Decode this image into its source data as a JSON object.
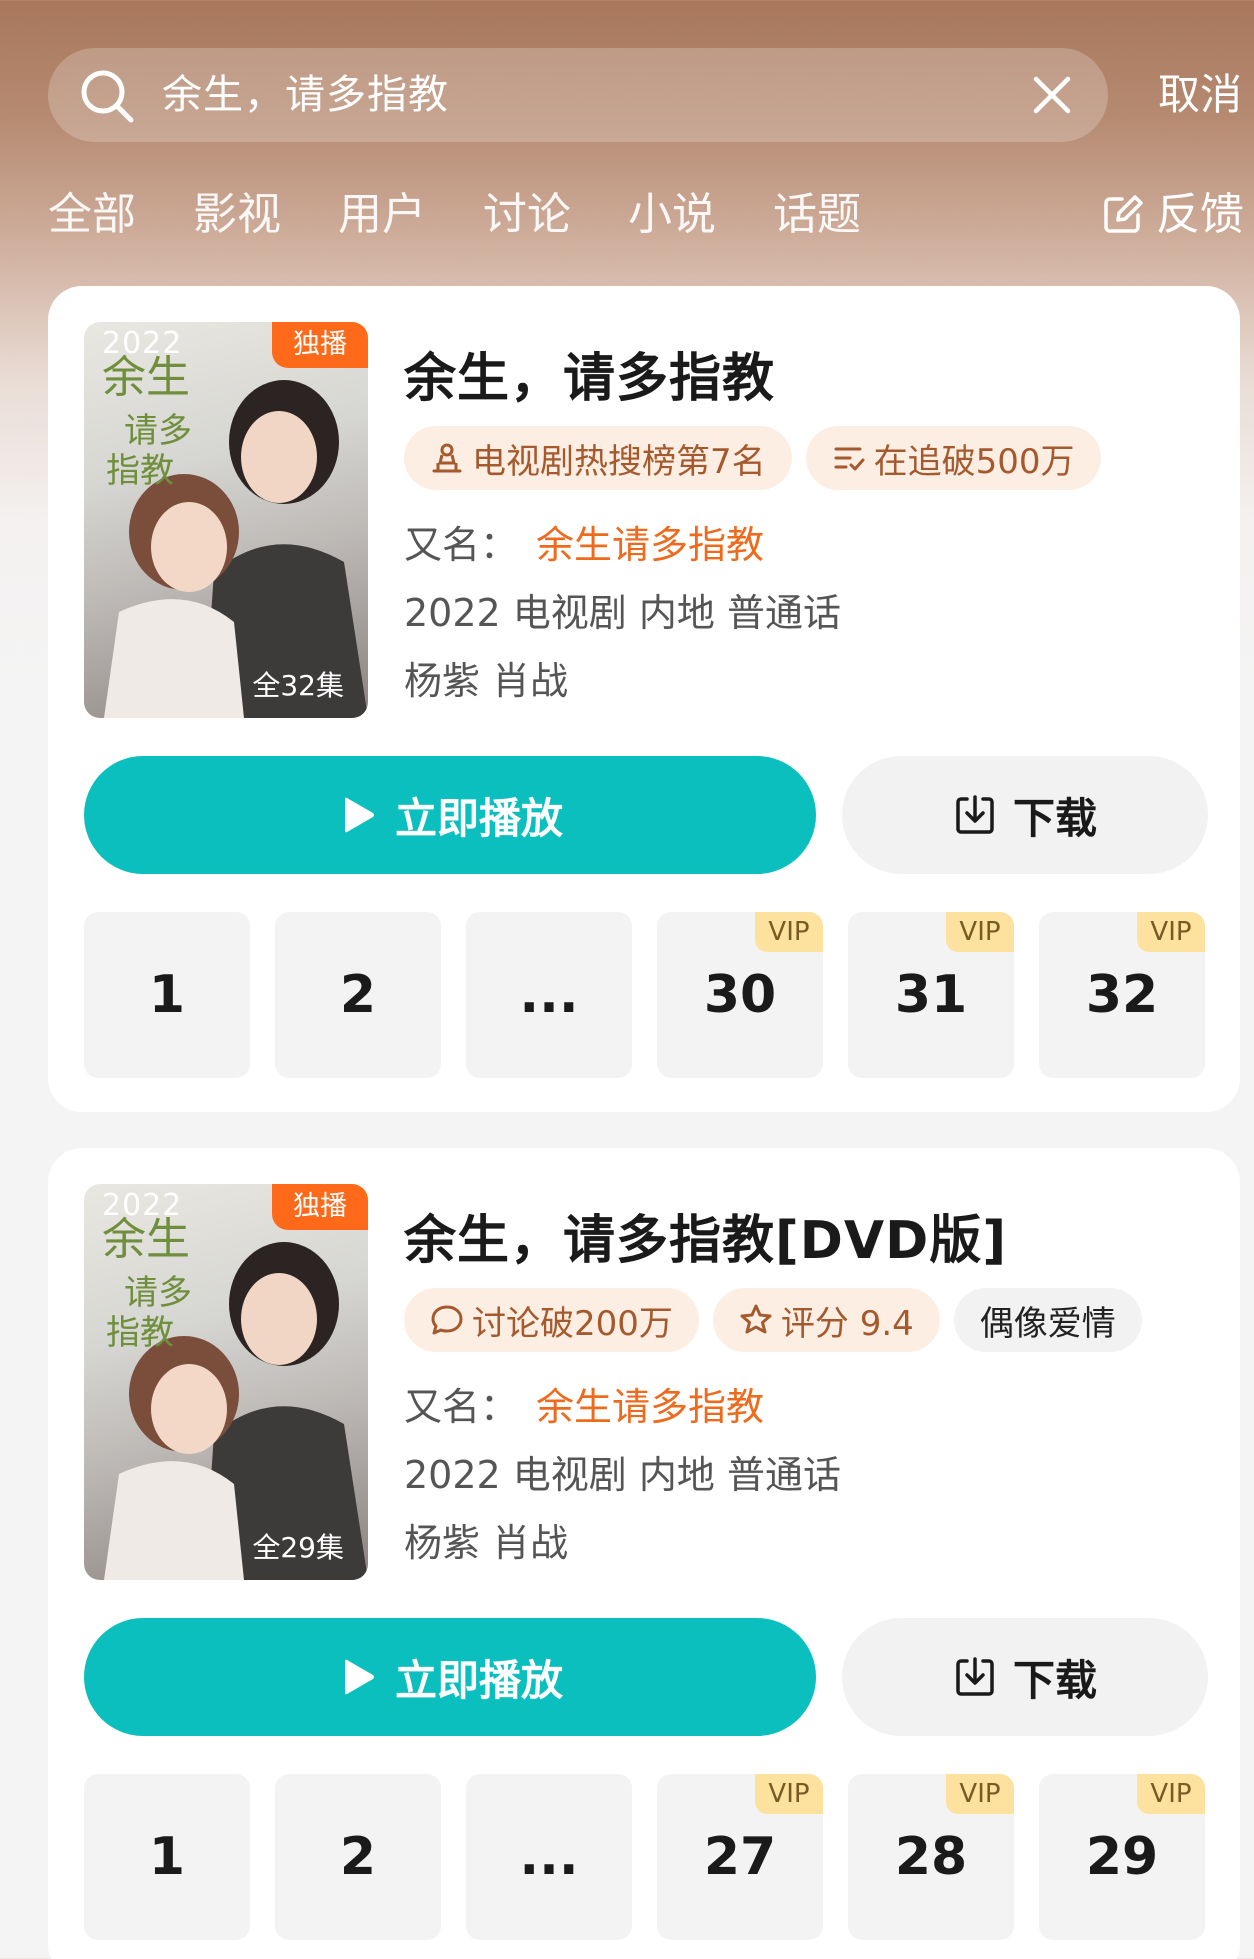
{
  "search": {
    "query": "余生，请多指教",
    "cancel_label": "取消"
  },
  "tabs": [
    "全部",
    "影视",
    "用户",
    "讨论",
    "小说",
    "话题"
  ],
  "feedback_label": "反馈",
  "results": [
    {
      "poster_year": "2022",
      "poster_badge": "独播",
      "poster_episodes": "全32集",
      "title": "余生，请多指教",
      "tags": [
        {
          "icon": "rank-icon",
          "text": "电视剧热搜榜第7名"
        },
        {
          "icon": "follow-list-icon",
          "text": "在追破500万"
        }
      ],
      "alias_label": "又名：",
      "alias_value": "余生请多指教",
      "meta": "2022 电视剧 内地 普通话",
      "cast": "杨紫 肖战",
      "play_label": "立即播放",
      "download_label": "下载",
      "episodes": [
        {
          "label": "1",
          "vip": ""
        },
        {
          "label": "2",
          "vip": ""
        },
        {
          "label": "...",
          "vip": ""
        },
        {
          "label": "30",
          "vip": "VIP"
        },
        {
          "label": "31",
          "vip": "VIP"
        },
        {
          "label": "32",
          "vip": "VIP"
        }
      ]
    },
    {
      "poster_year": "2022",
      "poster_badge": "独播",
      "poster_episodes": "全29集",
      "title": "余生，请多指教[DVD版]",
      "tags": [
        {
          "icon": "comment-icon",
          "text": "讨论破200万"
        },
        {
          "icon": "star-icon",
          "text": "评分 9.4"
        },
        {
          "icon": "",
          "text": "偶像爱情"
        }
      ],
      "alias_label": "又名：",
      "alias_value": "余生请多指教",
      "meta": "2022 电视剧 内地 普通话",
      "cast": "杨紫 肖战",
      "play_label": "立即播放",
      "download_label": "下载",
      "episodes": [
        {
          "label": "1",
          "vip": ""
        },
        {
          "label": "2",
          "vip": ""
        },
        {
          "label": "...",
          "vip": ""
        },
        {
          "label": "27",
          "vip": "VIP"
        },
        {
          "label": "28",
          "vip": "VIP"
        },
        {
          "label": "29",
          "vip": "VIP"
        }
      ]
    }
  ],
  "colors": {
    "accent_teal": "#0bbfbf",
    "alias_orange": "#ee6b1e",
    "exclusive_orange": "#ff6a1a",
    "vip_yellow": "#fce29e"
  }
}
